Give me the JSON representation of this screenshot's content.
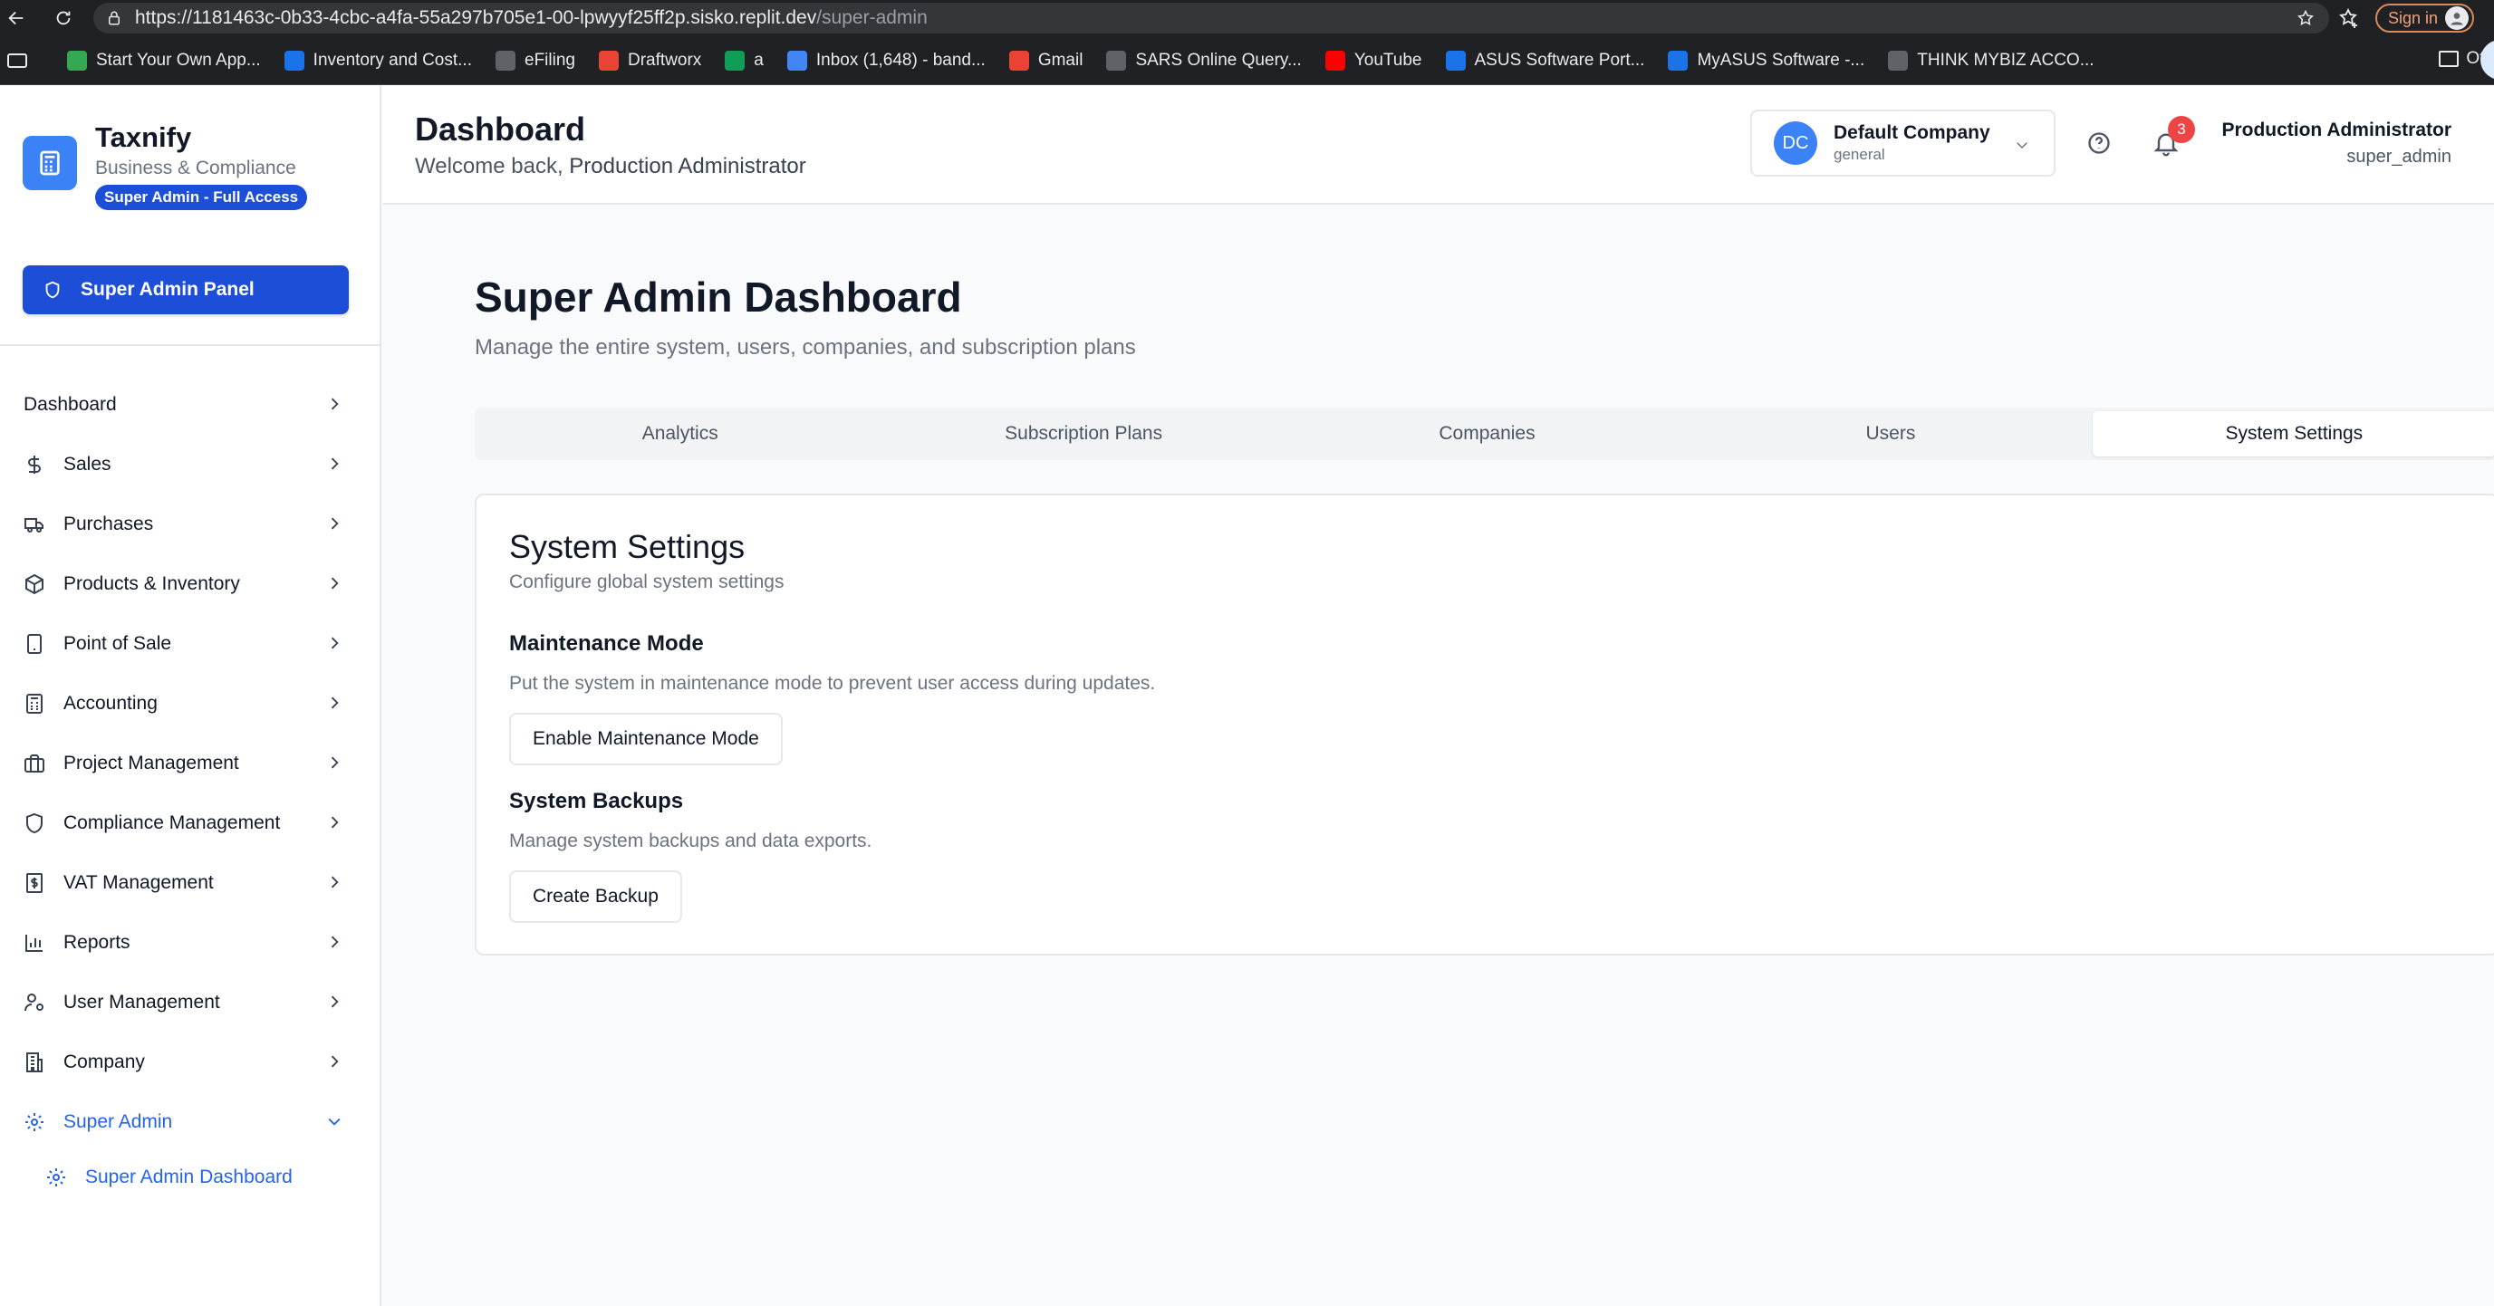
{
  "browser": {
    "url_host": "https://1181463c-0b33-4cbc-a4fa-55a297b705e1-00-lpwyyf25ff2p.sisko.replit.dev",
    "url_path": "/super-admin",
    "signin_label": "Sign in",
    "bookmarks": [
      {
        "label": "Start Your Own App...",
        "icon": "app-icon",
        "color": "#34a853"
      },
      {
        "label": "Inventory and Cost...",
        "icon": "ac-icon",
        "color": "#1a73e8"
      },
      {
        "label": "eFiling",
        "icon": "efiling-icon",
        "color": "#5f6368"
      },
      {
        "label": "Draftworx",
        "icon": "draftworx-icon",
        "color": "#ea4335"
      },
      {
        "label": "a",
        "icon": "leaf-icon",
        "color": "#0f9d58"
      },
      {
        "label": "Inbox (1,648) - band...",
        "icon": "google-icon",
        "color": "#4285f4"
      },
      {
        "label": "Gmail",
        "icon": "gmail-icon",
        "color": "#ea4335"
      },
      {
        "label": "SARS Online Query...",
        "icon": "globe-icon",
        "color": "#5f6368"
      },
      {
        "label": "YouTube",
        "icon": "youtube-icon",
        "color": "#ff0000"
      },
      {
        "label": "ASUS Software Port...",
        "icon": "asus-icon",
        "color": "#1a73e8"
      },
      {
        "label": "MyASUS Software -...",
        "icon": "myasus-icon",
        "color": "#1a73e8"
      },
      {
        "label": "THINK MYBIZ ACCO...",
        "icon": "think-icon",
        "color": "#5f6368"
      }
    ],
    "other_bookmarks": "Oth"
  },
  "brand": {
    "name": "Taxnify",
    "tagline": "Business & Compliance",
    "badge": "Super Admin - Full Access"
  },
  "sidebar": {
    "panel_button": "Super Admin Panel",
    "items": [
      {
        "label": "Dashboard",
        "icon": "none"
      },
      {
        "label": "Sales",
        "icon": "dollar-icon"
      },
      {
        "label": "Purchases",
        "icon": "truck-icon"
      },
      {
        "label": "Products & Inventory",
        "icon": "box-icon"
      },
      {
        "label": "Point of Sale",
        "icon": "tablet-icon"
      },
      {
        "label": "Accounting",
        "icon": "calculator-icon"
      },
      {
        "label": "Project Management",
        "icon": "briefcase-icon"
      },
      {
        "label": "Compliance Management",
        "icon": "shield-icon"
      },
      {
        "label": "VAT Management",
        "icon": "receipt-icon"
      },
      {
        "label": "Reports",
        "icon": "bar-chart-icon"
      },
      {
        "label": "User Management",
        "icon": "user-cog-icon"
      },
      {
        "label": "Company",
        "icon": "building-icon"
      },
      {
        "label": "Super Admin",
        "icon": "gear-icon"
      }
    ],
    "sub_item": "Super Admin Dashboard"
  },
  "header": {
    "title": "Dashboard",
    "welcome_prefix": "Welcome back, ",
    "welcome_name": "Production Administrator",
    "company_initials": "DC",
    "company_name": "Default Company",
    "company_type": "general",
    "notification_count": "3",
    "user_name": "Production Administrator",
    "user_role": "super_admin"
  },
  "main": {
    "title": "Super Admin Dashboard",
    "subtitle": "Manage the entire system, users, companies, and subscription plans",
    "tabs": [
      "Analytics",
      "Subscription Plans",
      "Companies",
      "Users",
      "System Settings"
    ],
    "active_tab": "System Settings"
  },
  "settings": {
    "title": "System Settings",
    "subtitle": "Configure global system settings",
    "maintenance_title": "Maintenance Mode",
    "maintenance_desc": "Put the system in maintenance mode to prevent user access during updates.",
    "maintenance_button": "Enable Maintenance Mode",
    "backup_title": "System Backups",
    "backup_desc": "Manage system backups and data exports.",
    "backup_button": "Create Backup"
  },
  "colors": {
    "primary": "#1d4ed8",
    "accent": "#2563eb",
    "badge_red": "#ef4444"
  }
}
